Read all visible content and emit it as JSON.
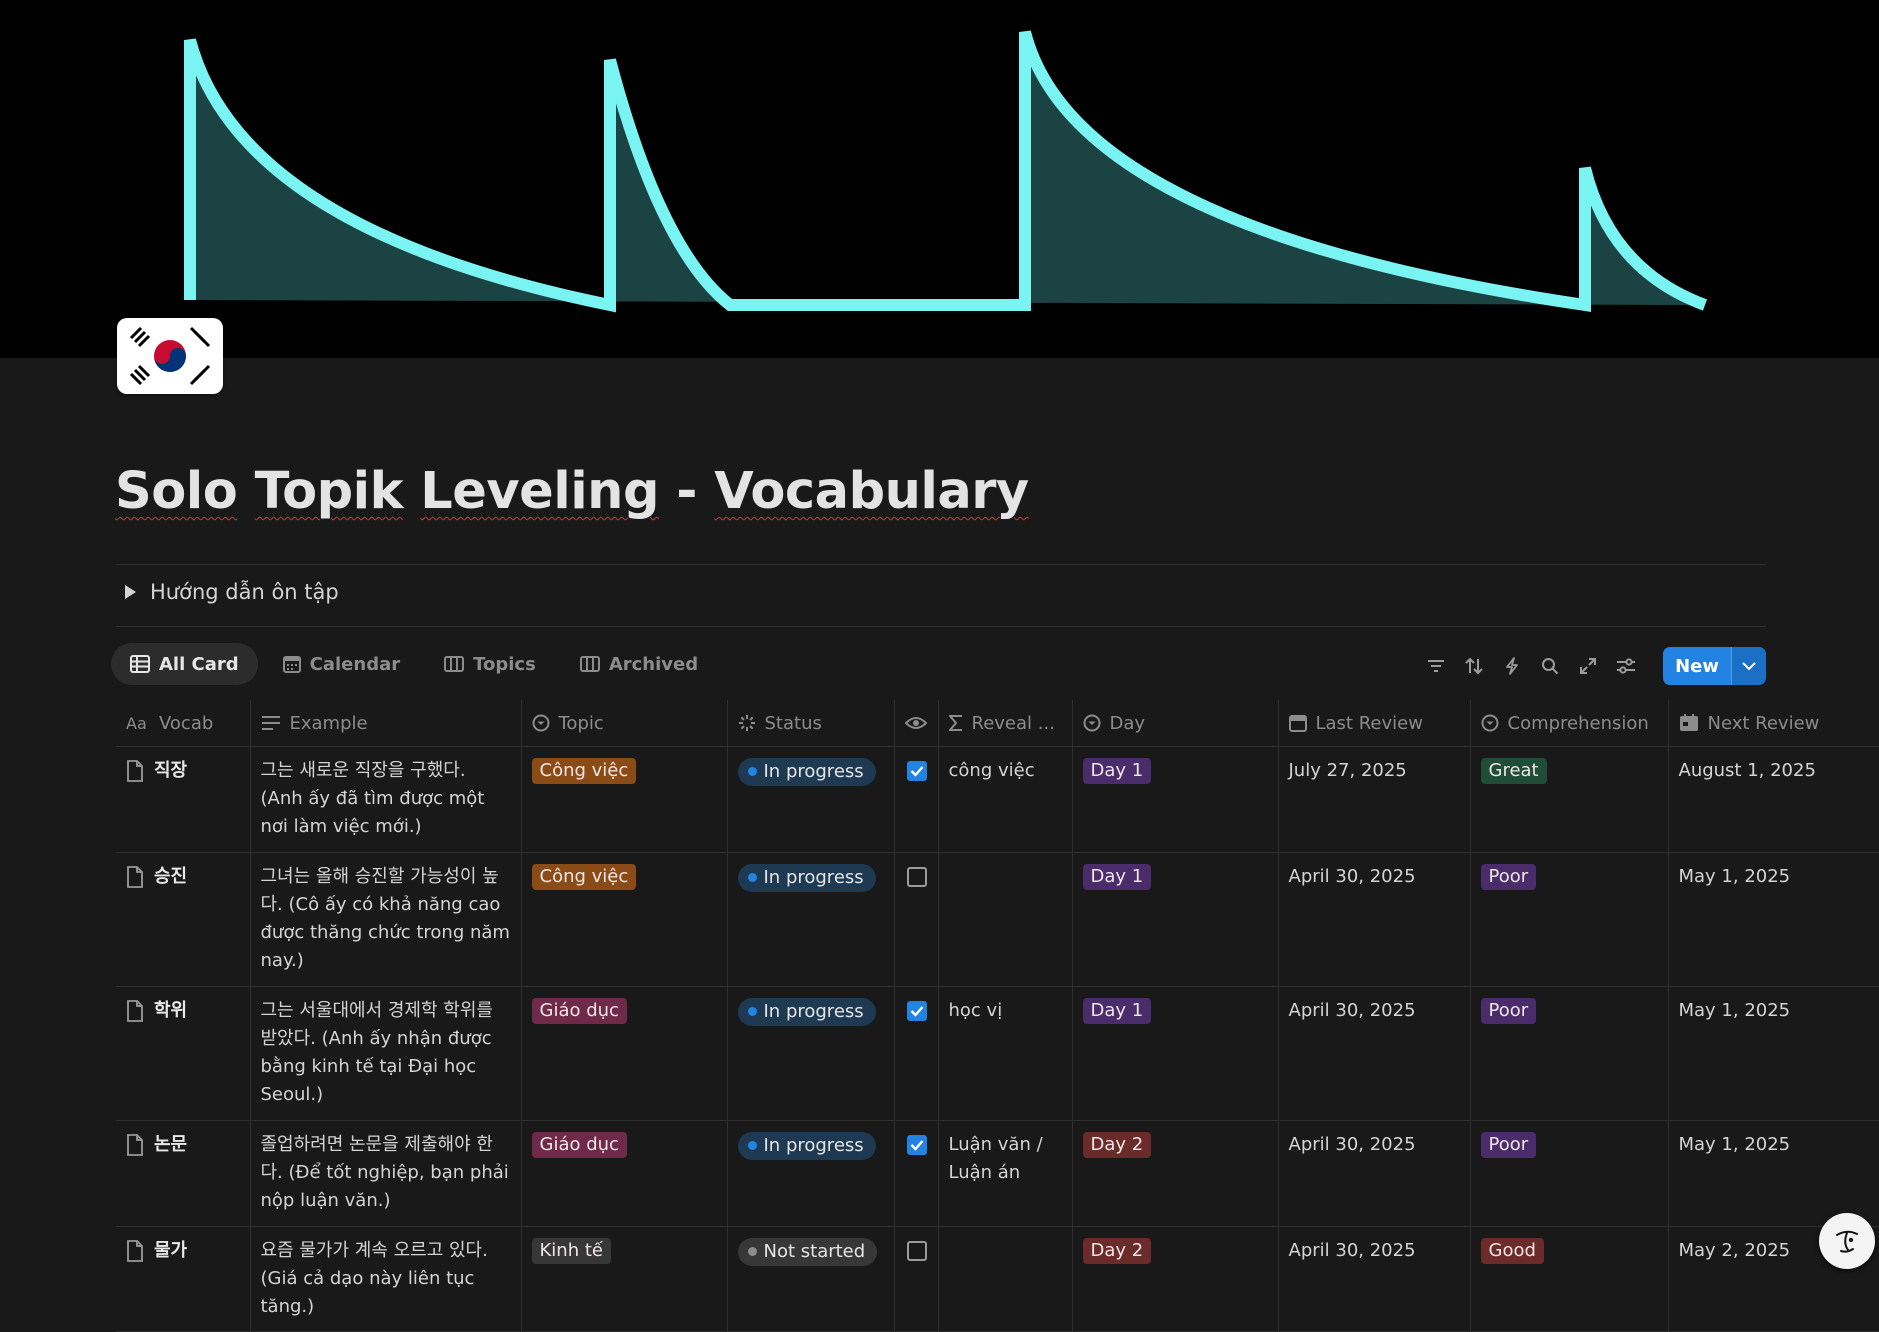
{
  "page": {
    "title": "Solo Topik Leveling - Vocabulary",
    "title_parts": [
      "Solo",
      "Topik",
      "Leveling",
      "-",
      "Vocabulary"
    ],
    "icon": "south-korea-flag-icon"
  },
  "toggle": {
    "label": "Hướng dẫn ôn tập"
  },
  "views": [
    {
      "label": "All Card",
      "icon": "table-icon",
      "active": true
    },
    {
      "label": "Calendar",
      "icon": "calendar-icon",
      "active": false
    },
    {
      "label": "Topics",
      "icon": "board-icon",
      "active": false
    },
    {
      "label": "Archived",
      "icon": "board-icon",
      "active": false
    }
  ],
  "toolbar": {
    "icons": [
      "filter-icon",
      "sort-icon",
      "automation-icon",
      "search-icon",
      "expand-icon",
      "settings-icon"
    ],
    "new_label": "New"
  },
  "columns": [
    {
      "label": "Vocab",
      "icon": "title-icon"
    },
    {
      "label": "Example",
      "icon": "text-icon"
    },
    {
      "label": "Topic",
      "icon": "select-icon"
    },
    {
      "label": "Status",
      "icon": "status-icon"
    },
    {
      "label": "",
      "icon": "eye-icon"
    },
    {
      "label": "Reveal ...",
      "icon": "formula-icon"
    },
    {
      "label": "Day",
      "icon": "select-icon"
    },
    {
      "label": "Last Review",
      "icon": "date-icon"
    },
    {
      "label": "Comprehension",
      "icon": "select-icon"
    },
    {
      "label": "Next Review",
      "icon": "date-formula-icon"
    }
  ],
  "rows": [
    {
      "vocab": "직장",
      "example": "그는 새로운 직장을 구했다. (Anh ấy đã tìm được một nơi làm việc mới.)",
      "topic": "Công việc",
      "status": "In progress",
      "reveal_checked": true,
      "reveal": "công việc",
      "day": "Day 1",
      "last_review": "July 27, 2025",
      "comprehension": "Great",
      "next_review": "August 1, 2025"
    },
    {
      "vocab": "승진",
      "example": "그녀는 올해 승진할 가능성이 높다. (Cô ấy có khả năng cao được thăng chức trong năm nay.)",
      "topic": "Công việc",
      "status": "In progress",
      "reveal_checked": false,
      "reveal": "",
      "day": "Day 1",
      "last_review": "April 30, 2025",
      "comprehension": "Poor",
      "next_review": "May 1, 2025"
    },
    {
      "vocab": "학위",
      "example": "그는 서울대에서 경제학 학위를 받았다. (Anh ấy nhận được bằng kinh tế tại Đại học Seoul.)",
      "topic": "Giáo dục",
      "status": "In progress",
      "reveal_checked": true,
      "reveal": "học vị",
      "day": "Day 1",
      "last_review": "April 30, 2025",
      "comprehension": "Poor",
      "next_review": "May 1, 2025"
    },
    {
      "vocab": "논문",
      "example": "졸업하려면 논문을 제출해야 한다. (Để tốt nghiệp, bạn phải nộp luận văn.)",
      "topic": "Giáo dục",
      "status": "In progress",
      "reveal_checked": true,
      "reveal": "Luận văn / Luận án",
      "day": "Day 2",
      "last_review": "April 30, 2025",
      "comprehension": "Poor",
      "next_review": "May 1, 2025"
    },
    {
      "vocab": "물가",
      "example": "요즘 물가가 계속 오르고 있다. (Giá cả dạo này liên tục tăng.)",
      "topic": "Kinh tế",
      "status": "Not started",
      "reveal_checked": false,
      "reveal": "",
      "day": "Day 2",
      "last_review": "April 30, 2025",
      "comprehension": "Good",
      "next_review": "May 2, 2025"
    }
  ],
  "colors": {
    "topic": {
      "Công việc": "#8a4b17",
      "Giáo dục": "#6e2a48",
      "Kinh tế": "#373737"
    },
    "status": {
      "In progress": "#1d3a52",
      "Not started": "#373737"
    },
    "status_dot": {
      "In progress": "#2383e2",
      "Not started": "#8c8c8c"
    },
    "day": {
      "Day 1": "#4a2c6b",
      "Day 2": "#6b2b2b"
    },
    "comprehension": {
      "Great": "#1f4d37",
      "Poor": "#4a2c6b",
      "Good": "#6b2b2b"
    },
    "accent": "#2383e2",
    "cover_curve": "#7af3f3"
  }
}
